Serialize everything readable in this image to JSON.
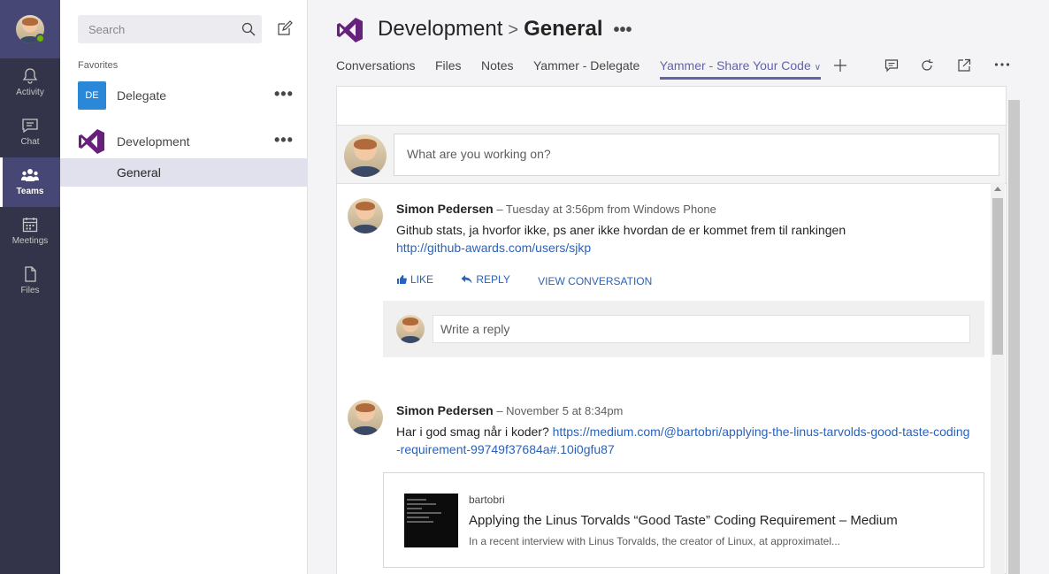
{
  "rail": {
    "items": [
      {
        "label": "Activity",
        "icon": "bell-icon"
      },
      {
        "label": "Chat",
        "icon": "chat-icon"
      },
      {
        "label": "Teams",
        "icon": "teams-icon",
        "active": true
      },
      {
        "label": "Meetings",
        "icon": "calendar-icon"
      },
      {
        "label": "Files",
        "icon": "file-icon"
      }
    ]
  },
  "panel": {
    "search_placeholder": "Search",
    "favorites_label": "Favorites",
    "teams": [
      {
        "badge": "DE",
        "name": "Delegate",
        "more": "•••"
      },
      {
        "name": "Development",
        "more": "•••"
      }
    ],
    "channel": "General"
  },
  "header": {
    "team": "Development",
    "separator": ">",
    "channel": "General",
    "more": "•••",
    "tabs": [
      "Conversations",
      "Files",
      "Notes",
      "Yammer - Delegate",
      "Yammer - Share Your Code"
    ],
    "active_tab": "Yammer - Share Your Code",
    "chevron": "∨"
  },
  "composer": {
    "placeholder": "What are you working on?"
  },
  "posts": [
    {
      "author": "Simon Pedersen",
      "meta": " – Tuesday at 3:56pm from Windows Phone",
      "text": "Github stats, ja hvorfor ikke, ps aner ikke hvordan de er kommet frem til rankingen",
      "link": "http://github-awards.com/users/sjkp",
      "actions": {
        "like": "LIKE",
        "reply": "REPLY",
        "view": "VIEW CONVERSATION"
      },
      "reply_placeholder": "Write a reply"
    },
    {
      "author": "Simon Pedersen",
      "meta": " – November 5 at 8:34pm",
      "text": "Har i god smag når i koder? ",
      "link": "https://medium.com/@bartobri/applying-the-linus-tarvolds-good-taste-coding-requirement-99749f37684a#.10i0gfu87",
      "preview": {
        "source": "bartobri",
        "title": "Applying the Linus Torvalds “Good Taste” Coding Requirement – Medium",
        "description": "In a recent interview with Linus Torvalds, the creator of Linux, at approximatel..."
      }
    }
  ],
  "colors": {
    "rail": "#33344a",
    "accent": "#6264a7",
    "link": "#2b62b9",
    "vs_purple": "#68217a"
  }
}
